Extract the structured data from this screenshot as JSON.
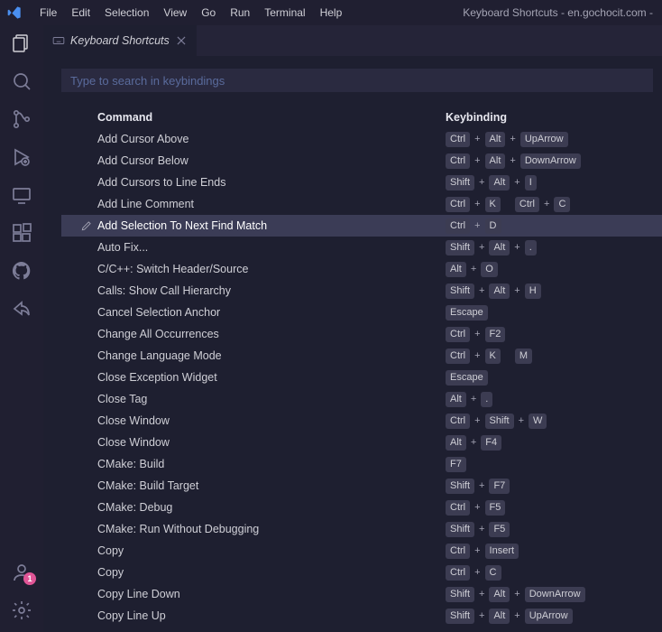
{
  "window_title": "Keyboard Shortcuts - en.gochocit.com -",
  "menu": [
    "File",
    "Edit",
    "Selection",
    "View",
    "Go",
    "Run",
    "Terminal",
    "Help"
  ],
  "tab": {
    "label": "Keyboard Shortcuts"
  },
  "search": {
    "placeholder": "Type to search in keybindings"
  },
  "columns": {
    "command": "Command",
    "keybinding": "Keybinding"
  },
  "account_badge": "1",
  "selected_index": 4,
  "rows": [
    {
      "command": "Add Cursor Above",
      "keys": [
        [
          "Ctrl",
          "Alt",
          "UpArrow"
        ]
      ]
    },
    {
      "command": "Add Cursor Below",
      "keys": [
        [
          "Ctrl",
          "Alt",
          "DownArrow"
        ]
      ]
    },
    {
      "command": "Add Cursors to Line Ends",
      "keys": [
        [
          "Shift",
          "Alt",
          "I"
        ]
      ]
    },
    {
      "command": "Add Line Comment",
      "keys": [
        [
          "Ctrl",
          "K"
        ],
        [
          "Ctrl",
          "C"
        ]
      ]
    },
    {
      "command": "Add Selection To Next Find Match",
      "keys": [
        [
          "Ctrl",
          "D"
        ]
      ]
    },
    {
      "command": "Auto Fix...",
      "keys": [
        [
          "Shift",
          "Alt",
          "."
        ]
      ]
    },
    {
      "command": "C/C++: Switch Header/Source",
      "keys": [
        [
          "Alt",
          "O"
        ]
      ]
    },
    {
      "command": "Calls: Show Call Hierarchy",
      "keys": [
        [
          "Shift",
          "Alt",
          "H"
        ]
      ]
    },
    {
      "command": "Cancel Selection Anchor",
      "keys": [
        [
          "Escape"
        ]
      ]
    },
    {
      "command": "Change All Occurrences",
      "keys": [
        [
          "Ctrl",
          "F2"
        ]
      ]
    },
    {
      "command": "Change Language Mode",
      "keys": [
        [
          "Ctrl",
          "K"
        ],
        [
          "M"
        ]
      ]
    },
    {
      "command": "Close Exception Widget",
      "keys": [
        [
          "Escape"
        ]
      ]
    },
    {
      "command": "Close Tag",
      "keys": [
        [
          "Alt",
          "."
        ]
      ]
    },
    {
      "command": "Close Window",
      "keys": [
        [
          "Ctrl",
          "Shift",
          "W"
        ]
      ]
    },
    {
      "command": "Close Window",
      "keys": [
        [
          "Alt",
          "F4"
        ]
      ]
    },
    {
      "command": "CMake: Build",
      "keys": [
        [
          "F7"
        ]
      ]
    },
    {
      "command": "CMake: Build Target",
      "keys": [
        [
          "Shift",
          "F7"
        ]
      ]
    },
    {
      "command": "CMake: Debug",
      "keys": [
        [
          "Ctrl",
          "F5"
        ]
      ]
    },
    {
      "command": "CMake: Run Without Debugging",
      "keys": [
        [
          "Shift",
          "F5"
        ]
      ]
    },
    {
      "command": "Copy",
      "keys": [
        [
          "Ctrl",
          "Insert"
        ]
      ]
    },
    {
      "command": "Copy",
      "keys": [
        [
          "Ctrl",
          "C"
        ]
      ]
    },
    {
      "command": "Copy Line Down",
      "keys": [
        [
          "Shift",
          "Alt",
          "DownArrow"
        ]
      ]
    },
    {
      "command": "Copy Line Up",
      "keys": [
        [
          "Shift",
          "Alt",
          "UpArrow"
        ]
      ]
    }
  ]
}
